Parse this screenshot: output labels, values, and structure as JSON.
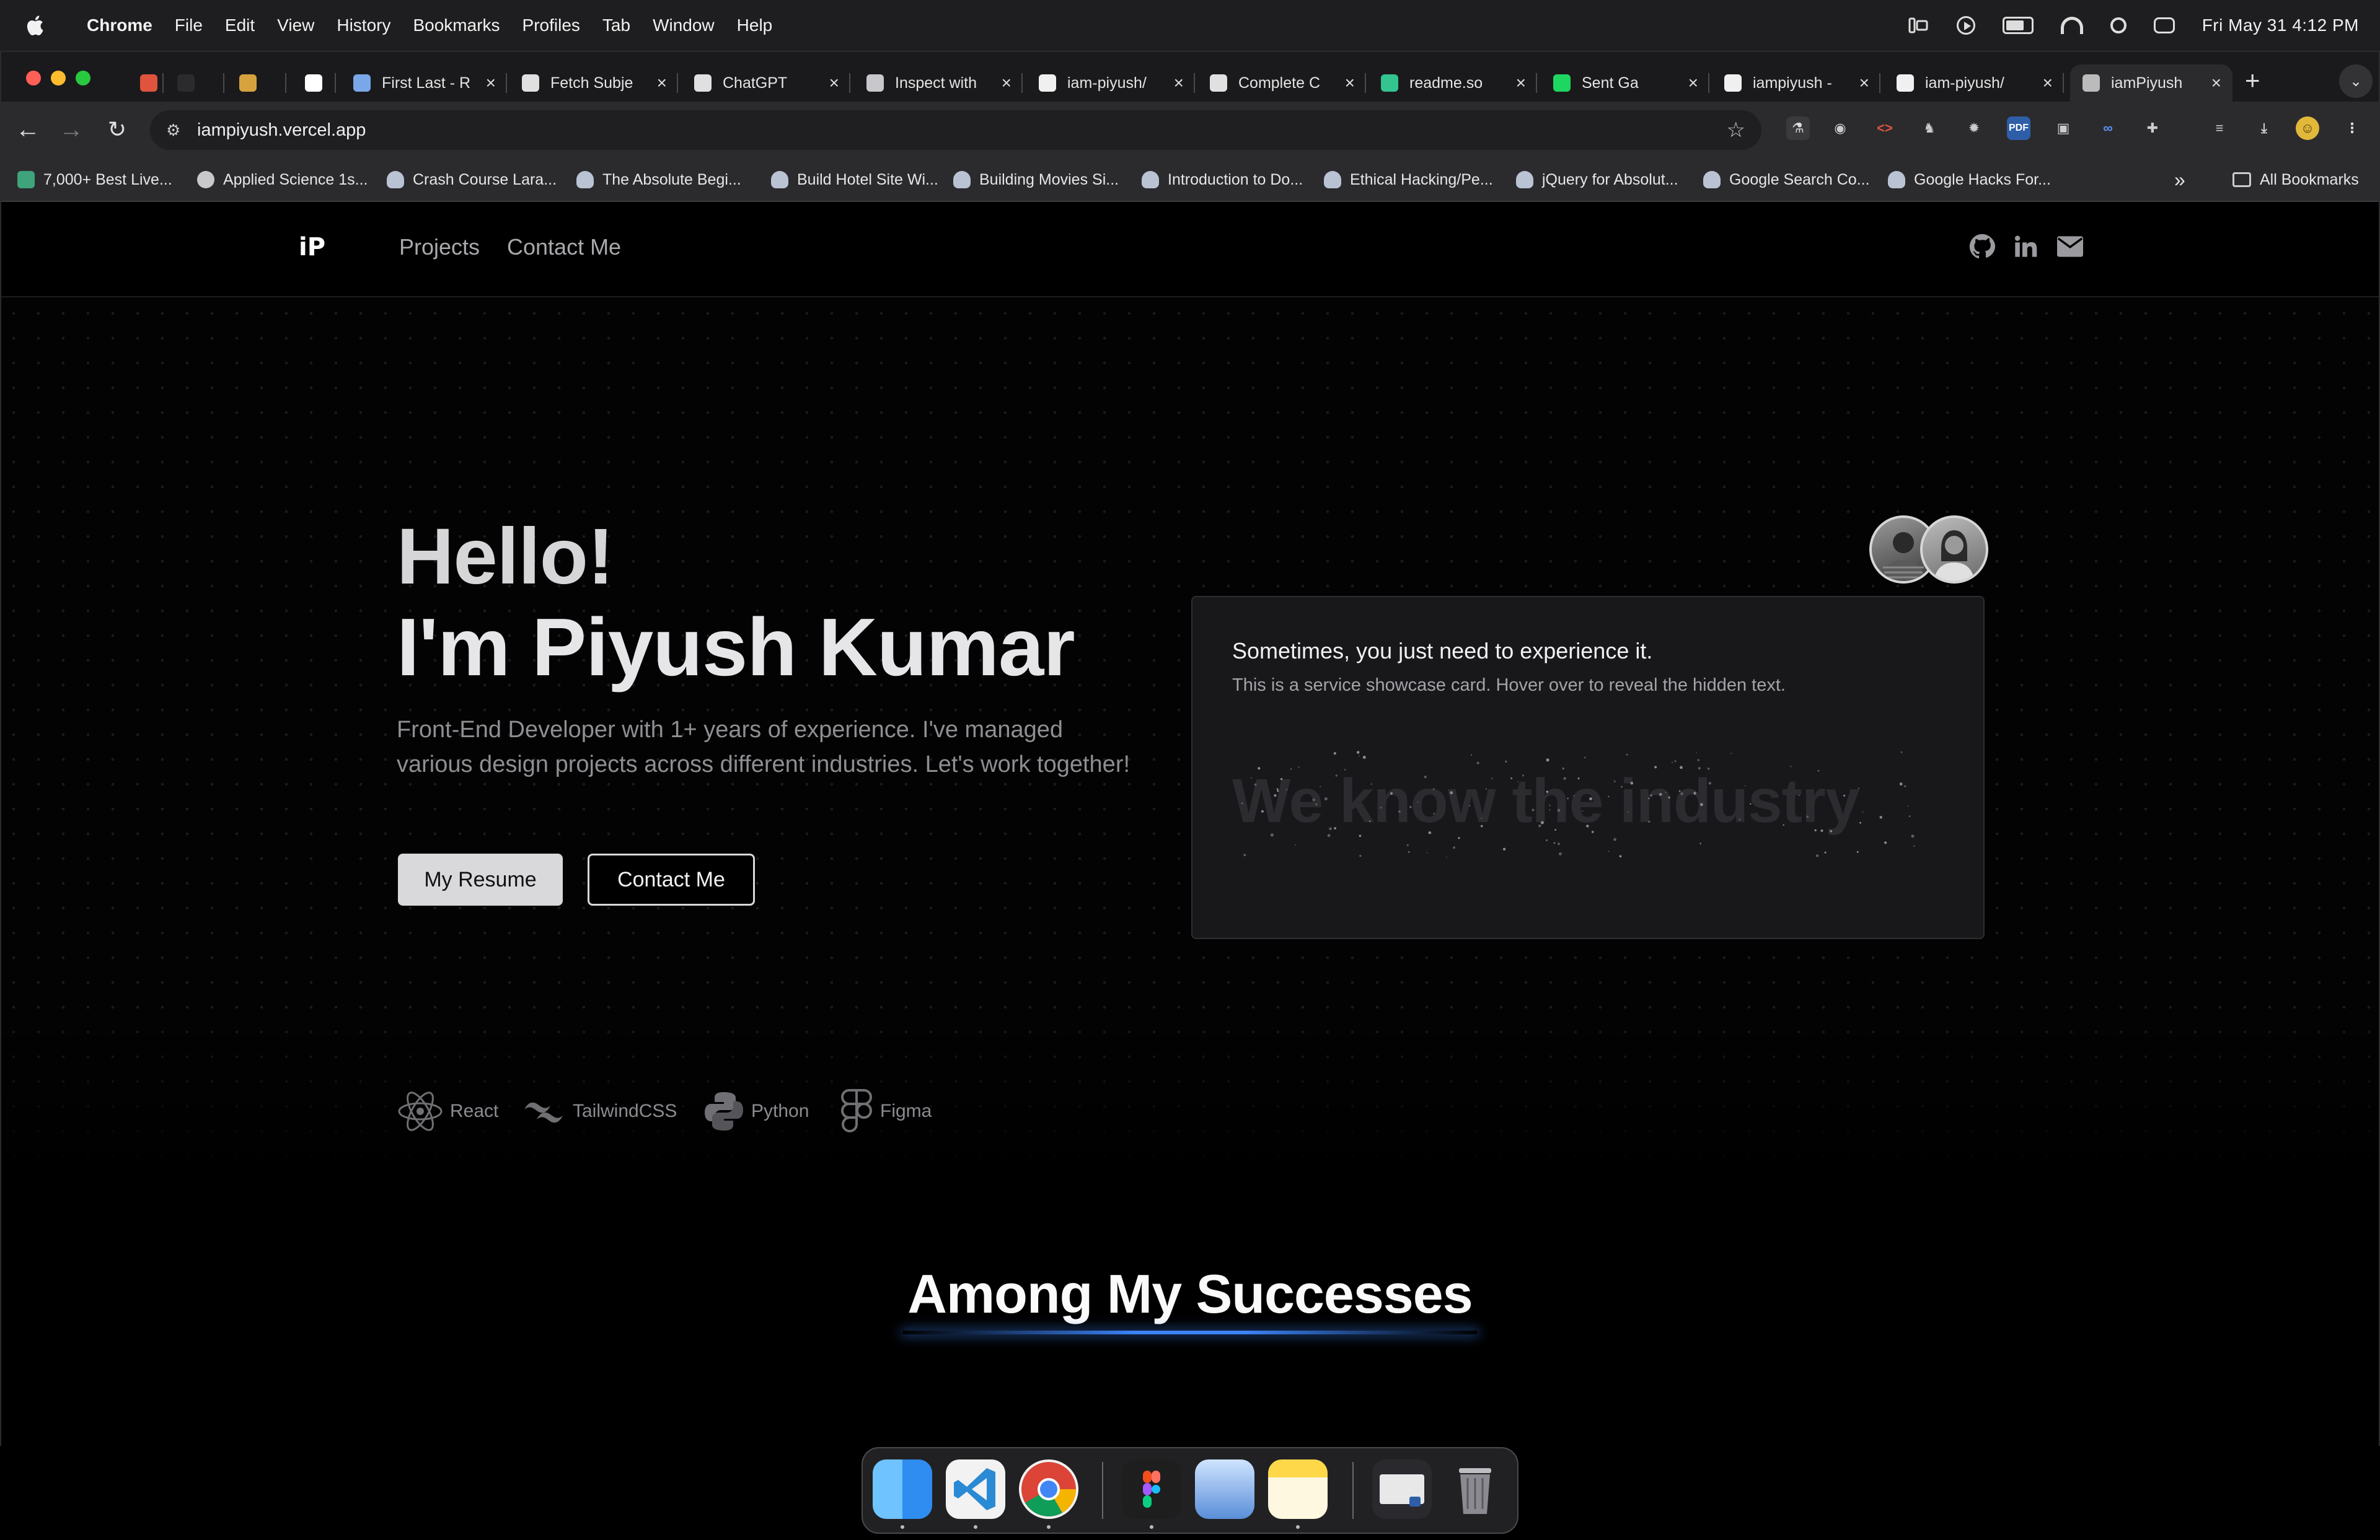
{
  "menubar": {
    "app": "Chrome",
    "items": [
      "File",
      "Edit",
      "View",
      "History",
      "Bookmarks",
      "Profiles",
      "Tab",
      "Window",
      "Help"
    ],
    "clock": "Fri May 31  4:12 PM"
  },
  "tabs": [
    {
      "title": "",
      "favicon": "red-arrow-icon",
      "color": "#e0533d"
    },
    {
      "title": "",
      "favicon": "blank-icon",
      "color": "#2b2b2e"
    },
    {
      "title": "",
      "favicon": "pencil-icon",
      "color": "#d6a23d"
    },
    {
      "title": "",
      "favicon": "letter-e-icon",
      "color": "#ffffff"
    },
    {
      "title": "First Last - R",
      "favicon": "doc-icon",
      "color": "#7aa7e8"
    },
    {
      "title": "Fetch Subje",
      "favicon": "chatgpt-icon",
      "color": "#e0e0e0"
    },
    {
      "title": "ChatGPT",
      "favicon": "chatgpt-icon",
      "color": "#e0e0e0"
    },
    {
      "title": "Inspect with",
      "favicon": "globe-icon",
      "color": "#c8c8cc"
    },
    {
      "title": "iam-piyush/",
      "favicon": "github-icon",
      "color": "#f0f0f0"
    },
    {
      "title": "Complete C",
      "favicon": "chatgpt-icon",
      "color": "#e0e0e0"
    },
    {
      "title": "readme.so",
      "favicon": "readme-icon",
      "color": "#33c48f"
    },
    {
      "title": "Sent Ga",
      "favicon": "spotify-icon",
      "color": "#1ed760"
    },
    {
      "title": "iampiyush -",
      "favicon": "vercel-icon",
      "color": "#f0f0f0"
    },
    {
      "title": "iam-piyush/",
      "favicon": "github-icon",
      "color": "#f0f0f0"
    },
    {
      "title": "iamPiyush",
      "favicon": "loading-icon",
      "color": "#bbbbbb",
      "active": true
    }
  ],
  "address": {
    "url": "iampiyush.vercel.app"
  },
  "bookmarks": [
    "7,000+ Best Live...",
    "Applied Science 1s...",
    "Crash Course Lara...",
    "The Absolute Begi...",
    "Build Hotel Site Wi...",
    "Building Movies Si...",
    "Introduction to Do...",
    "Ethical Hacking/Pe...",
    "jQuery for Absolut...",
    "Google Search Co...",
    "Google Hacks For..."
  ],
  "bookmarks_more": "»",
  "all_bookmarks": "All Bookmarks",
  "site": {
    "logo": "iP",
    "nav": {
      "projects": "Projects",
      "contact": "Contact Me"
    },
    "hero": {
      "hello": "Hello!",
      "name": "I'm Piyush Kumar",
      "tagline": "Front-End Developer with 1+ years of experience. I've managed various design projects across different industries. Let's work together!",
      "resume_button": "My Resume",
      "contact_button": "Contact Me",
      "skills": [
        "React",
        "TailwindCSS",
        "Python",
        "Figma"
      ]
    },
    "card": {
      "title": "Sometimes, you just need to experience it.",
      "description": "This is a service showcase card. Hover over to reveal the hidden text.",
      "hidden_text": "We know the industry"
    },
    "section_heading": "Among My Successes"
  },
  "colors": {
    "accent_glow": "#3b82f6",
    "background": "#000000",
    "card": "#18181b"
  }
}
